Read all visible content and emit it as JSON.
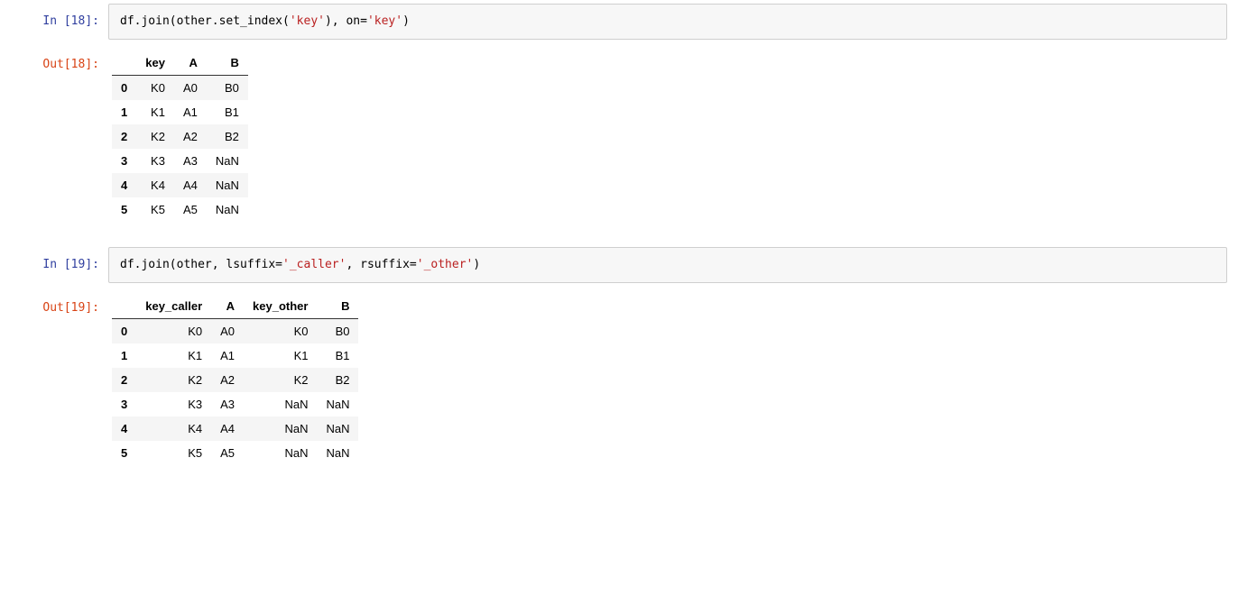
{
  "cells": [
    {
      "in_prompt": "In [18]:",
      "out_prompt": "Out[18]:",
      "code_tokens": [
        {
          "t": "df.join(other.set_index("
        },
        {
          "t": "'key'",
          "cls": "tok-str"
        },
        {
          "t": "), on="
        },
        {
          "t": "'key'",
          "cls": "tok-str"
        },
        {
          "t": ")"
        }
      ],
      "table": {
        "columns": [
          "key",
          "A",
          "B"
        ],
        "index": [
          "0",
          "1",
          "2",
          "3",
          "4",
          "5"
        ],
        "rows": [
          [
            "K0",
            "A0",
            "B0"
          ],
          [
            "K1",
            "A1",
            "B1"
          ],
          [
            "K2",
            "A2",
            "B2"
          ],
          [
            "K3",
            "A3",
            "NaN"
          ],
          [
            "K4",
            "A4",
            "NaN"
          ],
          [
            "K5",
            "A5",
            "NaN"
          ]
        ]
      }
    },
    {
      "in_prompt": "In [19]:",
      "out_prompt": "Out[19]:",
      "code_tokens": [
        {
          "t": "df.join(other, lsuffix="
        },
        {
          "t": "'_caller'",
          "cls": "tok-str"
        },
        {
          "t": ", rsuffix="
        },
        {
          "t": "'_other'",
          "cls": "tok-str"
        },
        {
          "t": ")"
        }
      ],
      "table": {
        "columns": [
          "key_caller",
          "A",
          "key_other",
          "B"
        ],
        "index": [
          "0",
          "1",
          "2",
          "3",
          "4",
          "5"
        ],
        "rows": [
          [
            "K0",
            "A0",
            "K0",
            "B0"
          ],
          [
            "K1",
            "A1",
            "K1",
            "B1"
          ],
          [
            "K2",
            "A2",
            "K2",
            "B2"
          ],
          [
            "K3",
            "A3",
            "NaN",
            "NaN"
          ],
          [
            "K4",
            "A4",
            "NaN",
            "NaN"
          ],
          [
            "K5",
            "A5",
            "NaN",
            "NaN"
          ]
        ]
      }
    }
  ]
}
